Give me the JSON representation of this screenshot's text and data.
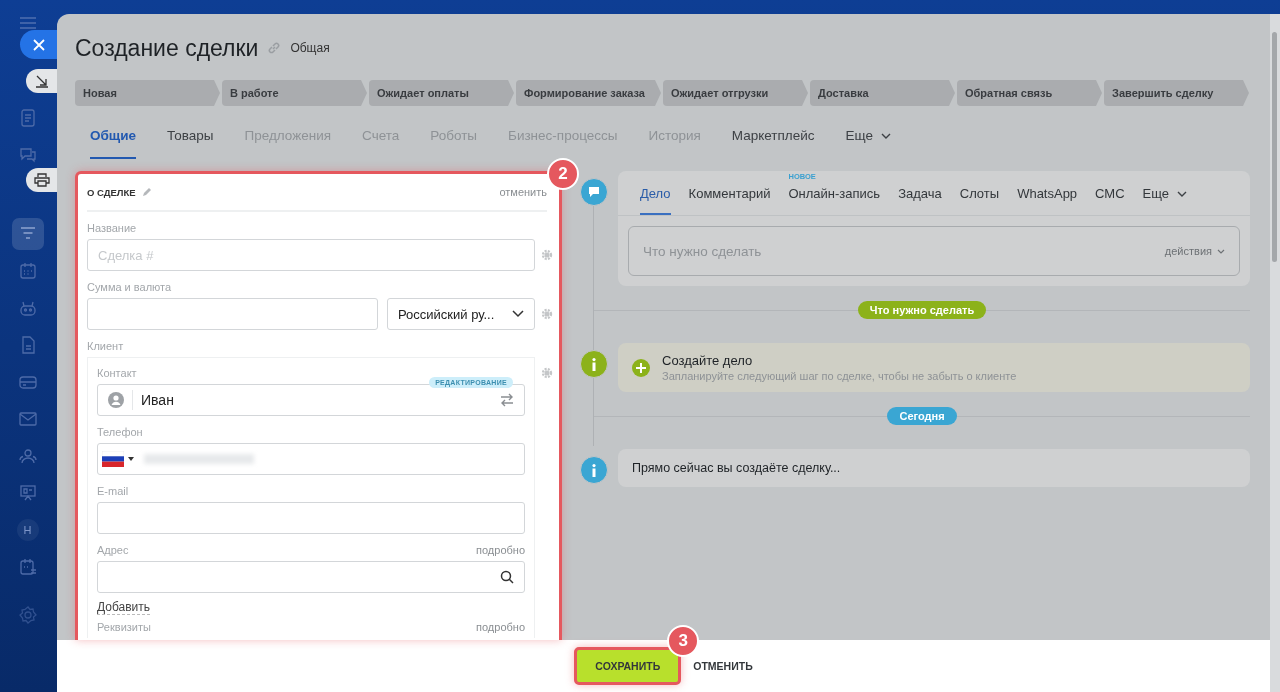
{
  "sidebar": {
    "items": [
      {
        "kind": "document",
        "selected": false
      },
      {
        "kind": "chat",
        "selected": false
      },
      {
        "kind": "funnel",
        "selected": true
      },
      {
        "kind": "calendar",
        "selected": false
      },
      {
        "kind": "robot",
        "selected": false
      },
      {
        "kind": "file",
        "selected": false
      },
      {
        "kind": "card",
        "selected": false
      },
      {
        "kind": "mail",
        "selected": false
      },
      {
        "kind": "people",
        "selected": false
      },
      {
        "kind": "presentation",
        "selected": false
      },
      {
        "kind": "avatar",
        "label": "H",
        "selected": false
      },
      {
        "kind": "schedule",
        "selected": false
      },
      {
        "kind": "gear",
        "selected": false
      }
    ]
  },
  "title": "Создание сделки",
  "category": "Общая",
  "stages": [
    {
      "label": "Новая"
    },
    {
      "label": "В работе"
    },
    {
      "label": "Ожидает оплаты"
    },
    {
      "label": "Формирование заказа"
    },
    {
      "label": "Ожидает отгрузки"
    },
    {
      "label": "Доставка"
    },
    {
      "label": "Обратная связь"
    },
    {
      "label": "Завершить сделку"
    }
  ],
  "tabs": [
    {
      "label": "Общие",
      "selected": true,
      "disabled": false
    },
    {
      "label": "Товары",
      "selected": false,
      "disabled": false
    },
    {
      "label": "Предложения",
      "selected": false,
      "disabled": true
    },
    {
      "label": "Счета",
      "selected": false,
      "disabled": true
    },
    {
      "label": "Роботы",
      "selected": false,
      "disabled": true
    },
    {
      "label": "Бизнес-процессы",
      "selected": false,
      "disabled": true
    },
    {
      "label": "История",
      "selected": false,
      "disabled": true
    },
    {
      "label": "Маркетплейс",
      "selected": false,
      "disabled": false
    },
    {
      "label": "Еще",
      "selected": false,
      "disabled": false,
      "kind": "more"
    }
  ],
  "about": {
    "heading": "О СДЕЛКЕ",
    "cancel": "отменить",
    "callout": "2",
    "name": {
      "label": "Название",
      "placeholder": "Сделка #"
    },
    "amount": {
      "label": "Сумма и валюта",
      "currency": "Российский ру..."
    },
    "client": {
      "label": "Клиент",
      "contact": {
        "label": "Контакт",
        "badge": "РЕДАКТИРОВАНИЕ",
        "value": "Иван"
      },
      "phone": {
        "label": "Телефон"
      },
      "email": {
        "label": "E-mail"
      },
      "address": {
        "label": "Адрес",
        "details": "подробно"
      },
      "add": "Добавить",
      "requisites": {
        "label": "Реквизиты",
        "details": "подробно"
      }
    }
  },
  "activity": {
    "tabs": [
      {
        "label": "Дело",
        "selected": true
      },
      {
        "label": "Комментарий",
        "selected": false
      },
      {
        "label": "Онлайн-запись",
        "selected": false,
        "badge": "НОВОЕ"
      },
      {
        "label": "Задача",
        "selected": false
      },
      {
        "label": "Слоты",
        "selected": false
      },
      {
        "label": "WhatsApp",
        "selected": false
      },
      {
        "label": "СМС",
        "selected": false
      },
      {
        "label": "Еще",
        "selected": false,
        "kind": "more"
      }
    ],
    "input": {
      "placeholder": "Что нужно сделать",
      "actions": "действия"
    }
  },
  "timeline": [
    {
      "kind": "divider",
      "label": "Что нужно сделать",
      "color": "#8cb21a"
    },
    {
      "kind": "todo",
      "title": "Создайте дело",
      "subtitle": "Запланируйте следующий шаг по сделке, чтобы не забыть о клиенте",
      "color": "#8cb21a"
    },
    {
      "kind": "divider",
      "label": "Сегодня",
      "color": "#3aa6d3"
    },
    {
      "kind": "info",
      "text": "Прямо сейчас вы создаёте сделку...",
      "color": "#3aa6d3"
    }
  ],
  "footer": {
    "save": "СОХРАНИТЬ",
    "cancel": "ОТМЕНИТЬ",
    "callout": "3"
  }
}
